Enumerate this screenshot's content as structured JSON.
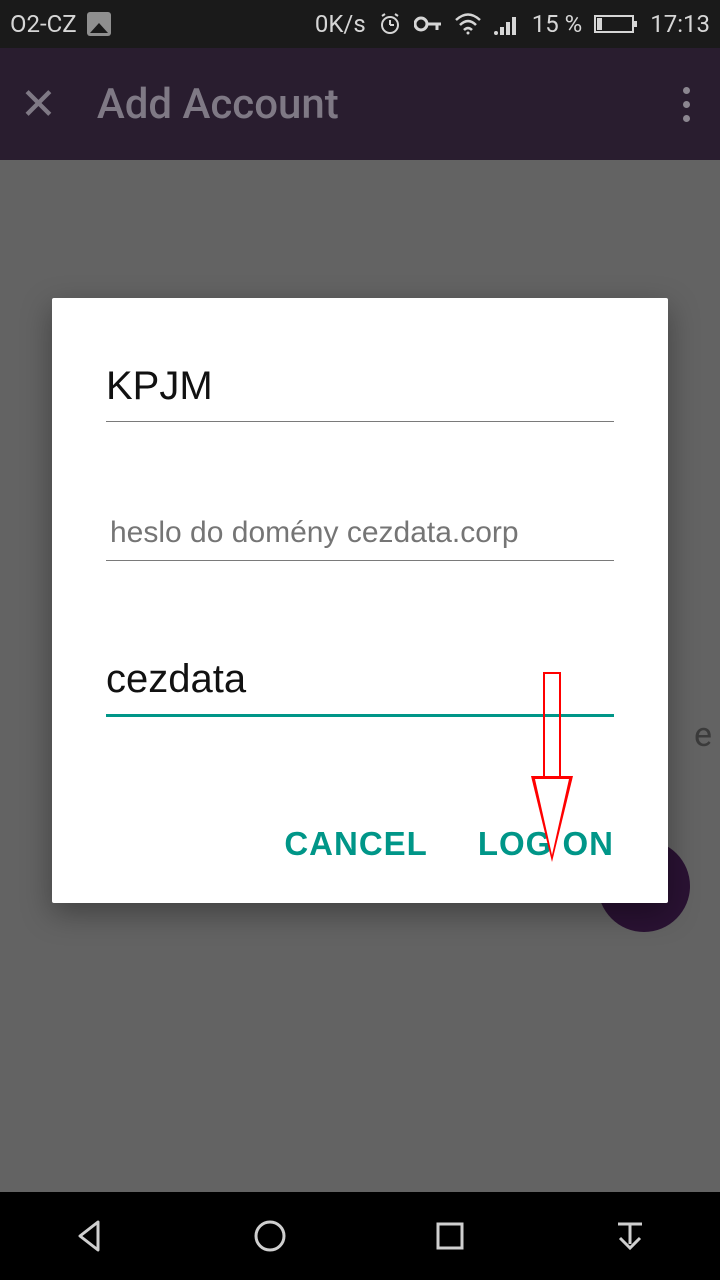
{
  "status": {
    "carrier": "O2-CZ",
    "speed": "0K/s",
    "battery_pct": "15 %",
    "time": "17:13"
  },
  "appbar": {
    "title": "Add Account"
  },
  "dialog": {
    "username_value": "KPJM",
    "password_placeholder": "heslo do domény cezdata.corp",
    "domain_value": "cezdata",
    "cancel_label": "CANCEL",
    "logon_label": "LOG ON"
  },
  "bg": {
    "visible_letter": "e"
  }
}
